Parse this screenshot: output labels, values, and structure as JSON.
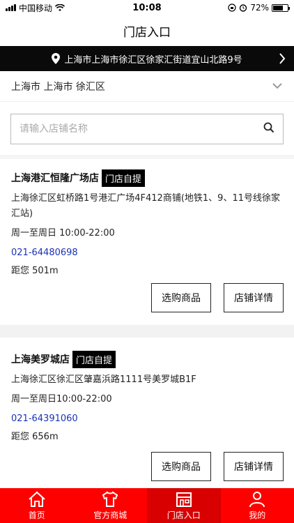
{
  "status_bar": {
    "carrier": "中国移动",
    "time": "10:08",
    "battery": "72%"
  },
  "nav": {
    "title": "门店入口"
  },
  "address": {
    "text": "上海市上海市徐汇区徐家汇街道宜山北路9号"
  },
  "region": {
    "text": "上海市 上海市 徐汇区"
  },
  "search": {
    "placeholder": "请输入店铺名称"
  },
  "stores": [
    {
      "name": "上海港汇恒隆广场店",
      "badge": "门店自提",
      "address": "上海徐汇区虹桥路1号港汇广场4F412商铺(地铁1、9、11号线徐家汇站)",
      "hours": "周一至周日 10:00-22:00",
      "phone": "021-64480698",
      "distance": "距您 501m",
      "buy_label": "选购商品",
      "detail_label": "店铺详情"
    },
    {
      "name": "上海美罗城店",
      "badge": "门店自提",
      "address": "上海徐汇区徐汇区肇嘉浜路1111号美罗城B1F",
      "hours": "周一至周日10:00-22:00",
      "phone": "021-64391060",
      "distance": "距您 656m",
      "buy_label": "选购商品",
      "detail_label": "店铺详情"
    }
  ],
  "tabs": [
    {
      "label": "首页",
      "icon": "home-icon"
    },
    {
      "label": "官方商城",
      "icon": "shirt-icon"
    },
    {
      "label": "门店入口",
      "icon": "store-icon"
    },
    {
      "label": "我的",
      "icon": "user-icon"
    }
  ],
  "colors": {
    "tab_bar": "#ff0000",
    "tab_active": "#d80000",
    "address_bar": "#0a0a0a",
    "phone": "#1a32b5"
  }
}
